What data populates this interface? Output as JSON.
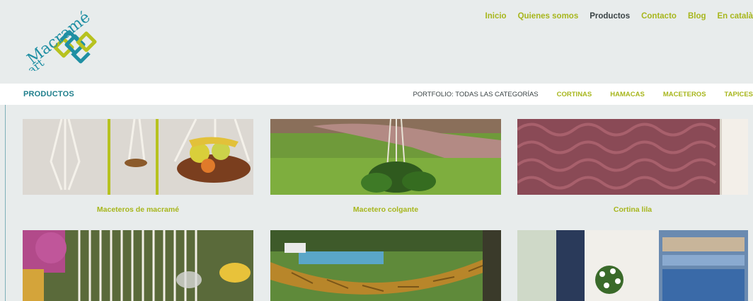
{
  "header": {
    "logo": {
      "line1": "Macramé",
      "line2": "art"
    },
    "nav": [
      {
        "label": "Inicio",
        "active": false
      },
      {
        "label": "Quienes somos",
        "active": false
      },
      {
        "label": "Productos",
        "active": true
      },
      {
        "label": "Contacto",
        "active": false
      },
      {
        "label": "Blog",
        "active": false
      },
      {
        "label": "En català",
        "active": false
      }
    ]
  },
  "subbar": {
    "title": "PRODUCTOS",
    "filters": [
      {
        "label": "PORTFOLIO: TODAS LAS CATEGORÍAS",
        "active": true
      },
      {
        "label": "CORTINAS",
        "active": false
      },
      {
        "label": "HAMACAS",
        "active": false
      },
      {
        "label": "MACETEROS",
        "active": false
      },
      {
        "label": "TAPICES",
        "active": false
      }
    ]
  },
  "products": [
    {
      "caption": "Maceteros de macramé"
    },
    {
      "caption": "Macetero colgante"
    },
    {
      "caption": "Cortina lila"
    }
  ],
  "colors": {
    "accent": "#a7b61c",
    "brand": "#1f7f8c",
    "active": "#3a4345"
  }
}
